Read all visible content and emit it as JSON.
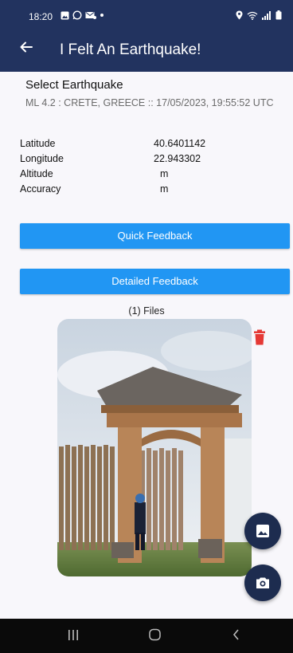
{
  "status_bar": {
    "time": "18:20"
  },
  "app_bar": {
    "title": "I Felt An Earthquake!"
  },
  "earthquake": {
    "heading": "Select Earthquake",
    "description": "ML 4.2 : CRETE, GREECE :: 17/05/2023, 19:55:52 UTC"
  },
  "location": [
    {
      "label": "Latitude",
      "value": "40.6401142"
    },
    {
      "label": "Longitude",
      "value": "22.943302"
    },
    {
      "label": "Altitude",
      "value": " m"
    },
    {
      "label": "Accuracy",
      "value": " m"
    }
  ],
  "buttons": {
    "quick_feedback": "Quick Feedback",
    "detailed_feedback": "Detailed Feedback"
  },
  "files": {
    "count_label": "(1) Files"
  },
  "colors": {
    "app_bar": "#22335f",
    "button": "#2196f3",
    "fab": "#1d2c4f",
    "delete": "#e53935"
  },
  "icons": {
    "back": "arrow-left-icon",
    "delete": "trash-icon",
    "gallery": "image-icon",
    "camera": "camera-icon"
  }
}
